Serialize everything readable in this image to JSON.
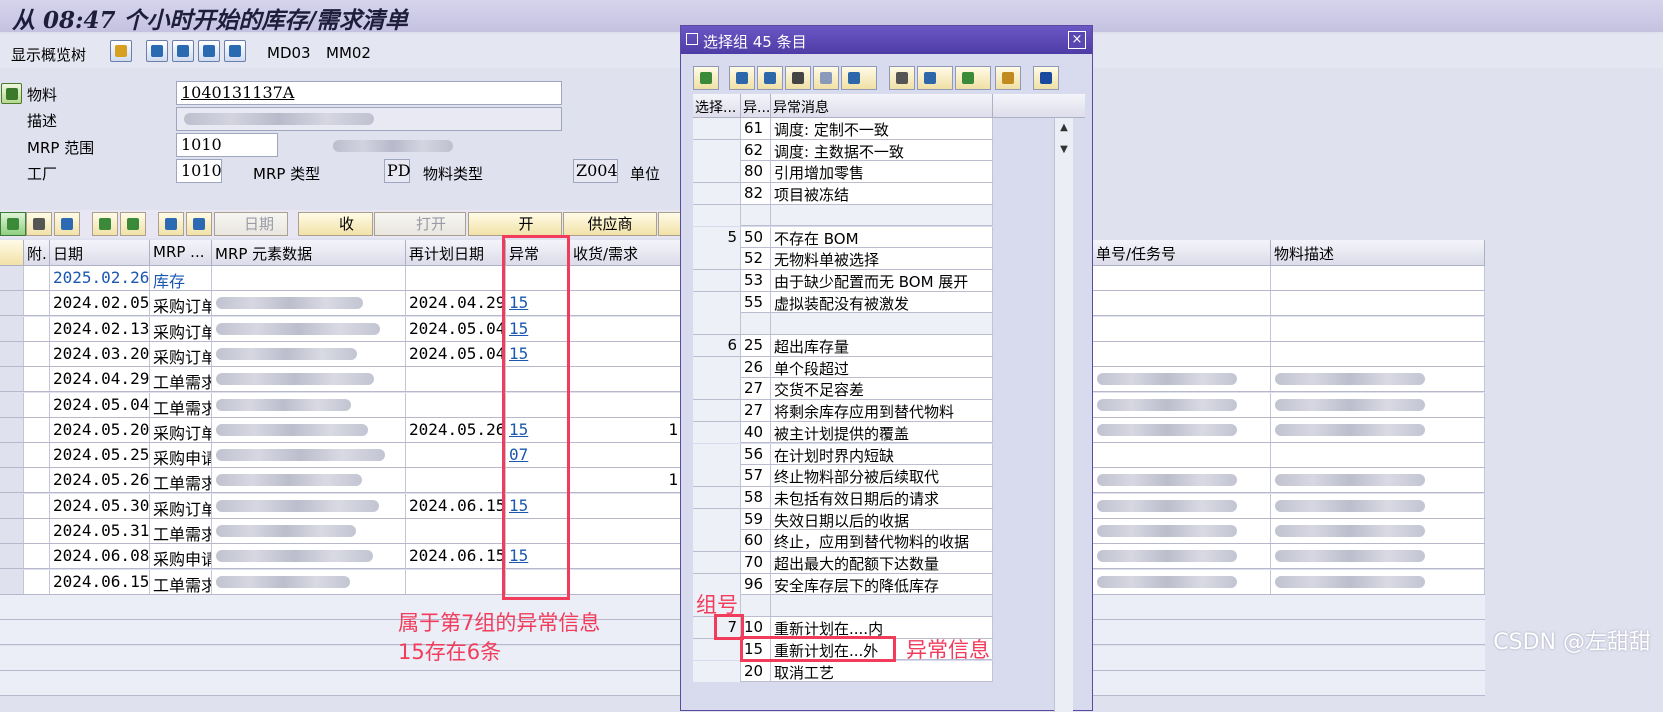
{
  "title": "从 08:47 个小时开始的库存/需求清单",
  "appbar": {
    "display_overview_tree": "显示概览树",
    "md03": "MD03",
    "mm02": "MM02"
  },
  "header": {
    "material_label": "物料",
    "material_value": "1040131137A",
    "description_label": "描述",
    "mrp_area_label": "MRP 范围",
    "mrp_area_value": "1010",
    "plant_label": "工厂",
    "plant_value": "1010",
    "mrp_type_label": "MRP 类型",
    "mrp_type_value": "PD",
    "material_type_label": "物料类型",
    "material_type_value": "Z004",
    "unit_label": "单位"
  },
  "grid_toolbar": {
    "date_label": "日期",
    "receipts_label": "收",
    "open_label": "打开",
    "open2_label": "开",
    "vendor_label": "供应商"
  },
  "grid": {
    "columns": [
      "附.",
      "日期",
      "MRP ...",
      "MRP 元素数据",
      "再计划日期",
      "异常",
      "收货/需求"
    ],
    "right_columns": [
      "单号/任务号",
      "物料描述"
    ],
    "rows": [
      {
        "date": "2025.02.26",
        "mrp": "库存",
        "reschedule": "",
        "exception": "",
        "qty": ""
      },
      {
        "date": "2024.02.05",
        "mrp": "采购订单",
        "reschedule": "2024.04.29",
        "exception": "15",
        "qty": ""
      },
      {
        "date": "2024.02.13",
        "mrp": "采购订单",
        "reschedule": "2024.05.04",
        "exception": "15",
        "qty": ""
      },
      {
        "date": "2024.03.20",
        "mrp": "采购订单",
        "reschedule": "2024.05.04",
        "exception": "15",
        "qty": ""
      },
      {
        "date": "2024.04.29",
        "mrp": "工单需求",
        "reschedule": "",
        "exception": "",
        "qty": ""
      },
      {
        "date": "2024.05.04",
        "mrp": "工单需求",
        "reschedule": "",
        "exception": "",
        "qty": ""
      },
      {
        "date": "2024.05.20",
        "mrp": "采购订单",
        "reschedule": "2024.05.26",
        "exception": "15",
        "qty": "1"
      },
      {
        "date": "2024.05.25",
        "mrp": "采购申请",
        "reschedule": "",
        "exception": "07",
        "qty": ""
      },
      {
        "date": "2024.05.26",
        "mrp": "工单需求",
        "reschedule": "",
        "exception": "",
        "qty": "1"
      },
      {
        "date": "2024.05.30",
        "mrp": "采购订单",
        "reschedule": "2024.06.15",
        "exception": "15",
        "qty": ""
      },
      {
        "date": "2024.05.31",
        "mrp": "工单需求",
        "reschedule": "",
        "exception": "",
        "qty": ""
      },
      {
        "date": "2024.06.08",
        "mrp": "采购申请",
        "reschedule": "2024.06.15",
        "exception": "15",
        "qty": ""
      },
      {
        "date": "2024.06.15",
        "mrp": "工单需求",
        "reschedule": "",
        "exception": "",
        "qty": ""
      }
    ]
  },
  "dialog": {
    "title": "选择组 45 条目",
    "columns": [
      "选择...",
      "异...",
      "异常消息"
    ],
    "rows": [
      {
        "group": "",
        "code": "61",
        "msg": "调度: 定制不一致"
      },
      {
        "group": "",
        "code": "62",
        "msg": "调度: 主数据不一致"
      },
      {
        "group": "",
        "code": "80",
        "msg": "引用增加零售"
      },
      {
        "group": "",
        "code": "82",
        "msg": "项目被冻结"
      },
      {
        "group": "",
        "code": "",
        "msg": ""
      },
      {
        "group": "5",
        "code": "50",
        "msg": "不存在 BOM"
      },
      {
        "group": "",
        "code": "52",
        "msg": "无物料单被选择"
      },
      {
        "group": "",
        "code": "53",
        "msg": "由于缺少配置而无 BOM 展开"
      },
      {
        "group": "",
        "code": "55",
        "msg": "虚拟装配没有被激发"
      },
      {
        "group": "",
        "code": "",
        "msg": ""
      },
      {
        "group": "6",
        "code": "25",
        "msg": "超出库存量"
      },
      {
        "group": "",
        "code": "26",
        "msg": "单个段超过"
      },
      {
        "group": "",
        "code": "27",
        "msg": "交货不足容差"
      },
      {
        "group": "",
        "code": "27",
        "msg": "将剩余库存应用到替代物料"
      },
      {
        "group": "",
        "code": "40",
        "msg": "被主计划提供的覆盖"
      },
      {
        "group": "",
        "code": "56",
        "msg": "在计划时界内短缺"
      },
      {
        "group": "",
        "code": "57",
        "msg": "终止物料部分被后续取代"
      },
      {
        "group": "",
        "code": "58",
        "msg": "未包括有效日期后的请求"
      },
      {
        "group": "",
        "code": "59",
        "msg": "失效日期以后的收据"
      },
      {
        "group": "",
        "code": "60",
        "msg": "终止，应用到替代物料的收据"
      },
      {
        "group": "",
        "code": "70",
        "msg": "超出最大的配额下达数量"
      },
      {
        "group": "",
        "code": "96",
        "msg": "安全库存层下的降低库存"
      },
      {
        "group": "",
        "code": "",
        "msg": ""
      },
      {
        "group": "7",
        "code": "10",
        "msg": "重新计划在....内"
      },
      {
        "group": "",
        "code": "15",
        "msg": "重新计划在...外"
      },
      {
        "group": "",
        "code": "20",
        "msg": "取消工艺"
      }
    ]
  },
  "annotations": {
    "group7_note_line1": "属于第7组的异常信息",
    "group7_note_line2": "15存在6条",
    "group_number": "组号",
    "exception_info": "异常信息",
    "accent_color": "#f23c5c"
  },
  "watermark": "CSDN @左甜甜"
}
